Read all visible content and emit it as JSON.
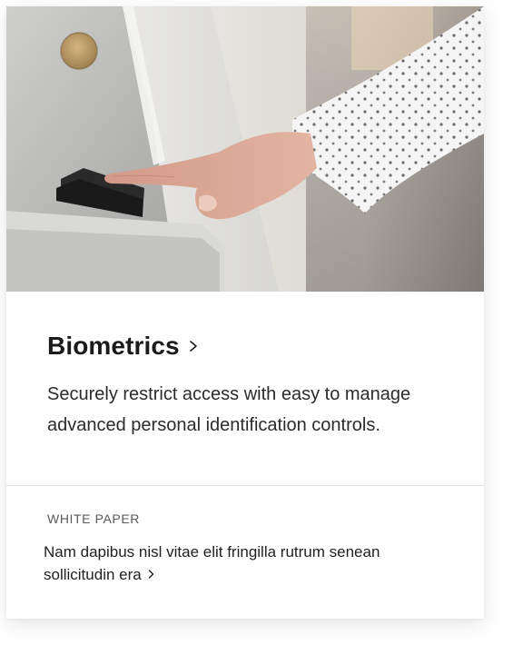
{
  "card": {
    "image": {
      "subject": "hand-pressing-fingerprint-scanner"
    },
    "title": "Biometrics",
    "title_icon": "chevron-right-icon",
    "description": "Securely restrict access with easy to manage advanced personal identification controls.",
    "footer": {
      "kicker": "WHITE PAPER",
      "link_text": "Nam dapibus nisl vitae elit fringilla rutrum senean sollicitudin era",
      "link_icon": "chevron-right-icon"
    }
  },
  "colors": {
    "text_primary": "#1b1b1b",
    "text_secondary": "#5a5a5a",
    "divider": "#dcdcdc",
    "card_background": "#ffffff"
  }
}
